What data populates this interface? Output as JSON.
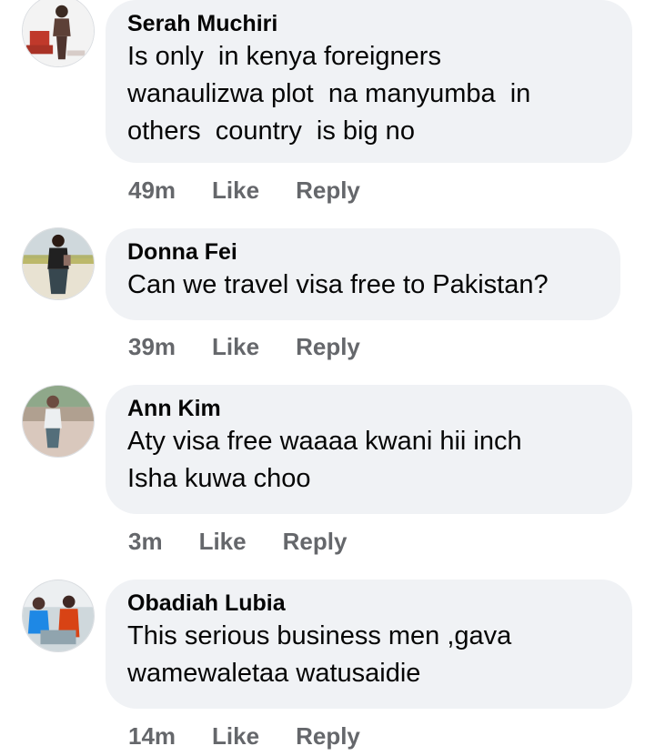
{
  "comments": [
    {
      "author": "Serah Muchiri",
      "lines": [
        "Is only  in kenya foreigners",
        "wanaulizwa plot  na manyumba  in",
        "others  country  is big no"
      ],
      "time": "49m",
      "like_label": "Like",
      "reply_label": "Reply"
    },
    {
      "author": "Donna Fei",
      "lines": [
        "Can we travel visa free to Pakistan?"
      ],
      "time": "39m",
      "like_label": "Like",
      "reply_label": "Reply"
    },
    {
      "author": "Ann Kim",
      "lines": [
        "Aty visa free waaaa kwani hii inch",
        "Isha kuwa choo"
      ],
      "time": "3m",
      "like_label": "Like",
      "reply_label": "Reply"
    },
    {
      "author": "Obadiah Lubia",
      "lines": [
        "This serious business men ,gava",
        "wamewaletaa watusaidie"
      ],
      "time": "14m",
      "like_label": "Like",
      "reply_label": "Reply"
    }
  ],
  "colors": {
    "bubble_bg": "#f0f2f5",
    "action_text": "#65676b",
    "text": "#050505"
  }
}
